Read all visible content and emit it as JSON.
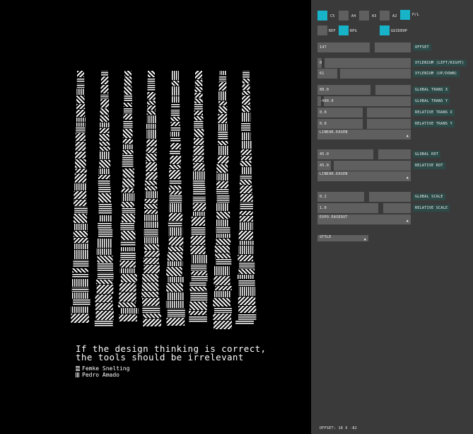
{
  "artwork": {
    "quote_line1": "If the design thinking is correct,",
    "quote_line2": "the tools should be irrelevant",
    "credit1": "Femke Snelting",
    "credit2": "Pedro Amado"
  },
  "panel": {
    "formats": [
      {
        "label": "C5",
        "checked": true
      },
      {
        "label": "A4",
        "checked": false
      },
      {
        "label": "A3",
        "checked": false
      },
      {
        "label": "A2",
        "checked": false
      },
      {
        "label": "P/L",
        "checked": true
      }
    ],
    "options": [
      {
        "label": "REF",
        "checked": false
      },
      {
        "label": "RPG",
        "checked": true
      },
      {
        "label": "GUIDEHP",
        "checked": true
      }
    ],
    "offset": {
      "value": "147",
      "label": "OFFSET"
    },
    "xylenium_lr": {
      "value": "0",
      "label": "XYLENIUM (LEFT/RIGHT)"
    },
    "xylenium_ud": {
      "value": "61",
      "label": "XYLENIUM (UP/DOWN)"
    },
    "global_trans_x": {
      "value": "80.0",
      "label": "GLOBAL TRANS X"
    },
    "global_trans_y": {
      "value": "-400.0",
      "label": "GLOBAL TRANS Y"
    },
    "relative_trans_x": {
      "value": "0.0",
      "label": "RELATIVE TRANS X"
    },
    "relative_trans_y": {
      "value": "0.0",
      "label": "RELATIVE TRANS Y"
    },
    "ease_trans": "LINEAR.EASEN",
    "global_rot": {
      "value": "45.0",
      "label": "GLOBAL ROT"
    },
    "relative_rot": {
      "value": "45.0",
      "label": "RELATIVE ROT"
    },
    "ease_rot": "LINEAR.EASEN",
    "global_scale": {
      "value": "0.2",
      "label": "GLOBAL SCALE"
    },
    "relative_scale": {
      "value": "1.0",
      "label": "RELATIVE SCALE"
    },
    "ease_scale": "EXPO.EASEOUT",
    "style": "STYLE",
    "status": "OFFSET: 18 X -82"
  }
}
